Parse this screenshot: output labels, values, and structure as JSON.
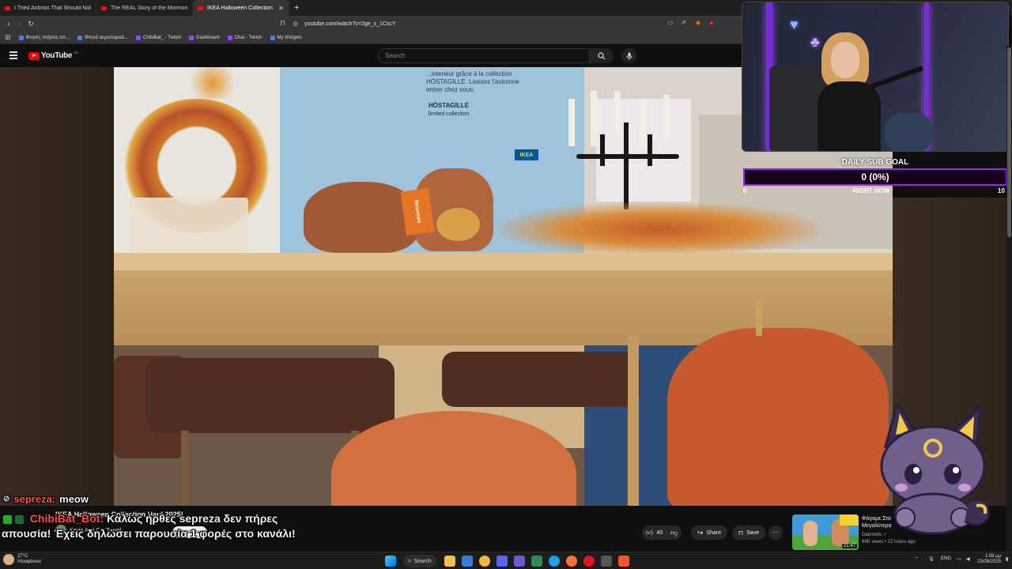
{
  "browser": {
    "tabs": [
      {
        "title": "I Tried Airbnbs That Should Not Exist",
        "active": false
      },
      {
        "title": "The REAL Story of the Mormon Church",
        "active": false
      },
      {
        "title": "IKEA Halloween Collection Haul 2025!",
        "active": true
      }
    ],
    "url": "youtube.com/watch?v=2ge_s_1CscY",
    "bookmarks": [
      "Φτηνές πτήσεις απ...",
      "Φτηνά αεροπορικά...",
      "ChibiBat_ - Twitch",
      "Dashboard",
      "Chat - Twitch",
      "My Widgets"
    ]
  },
  "youtube": {
    "logo_text": "YouTube",
    "country_code": "GR",
    "search_placeholder": "Search"
  },
  "scene": {
    "sign_line1": "...inteneur grâce à la collection",
    "sign_line2": "HÖSTAGILLE. Laissez l'automne",
    "sign_line3": "entrer chez vous.",
    "sign_title": "HÖSTAGILLE",
    "sign_sub": "limited collection",
    "tag_text": "Nouveau",
    "brand": "IKEA"
  },
  "sub_goal": {
    "title": "DAILY SUB GOAL",
    "value_text": "0 (0%)",
    "progress": 0,
    "min": "0",
    "max": "10",
    "label_now": "RIGHT NOW",
    "bar_color": "#a020f0"
  },
  "chat": [
    {
      "user": "sepreza:",
      "message": "meow"
    },
    {
      "user": "ChibiBat_Bot:",
      "message": "Καλώς ήρθες sepreza δεν πήρες"
    },
    {
      "message": "απουσία! Έχεις δηλώσει παρουσία 1 φορές στο κανάλι!"
    }
  ],
  "video": {
    "title": "IKEA Halloween Collection Haul 2025!",
    "channel": "Kevin And Cat Travel",
    "subscribe_label": "Subscribe",
    "likes": "40",
    "share_label": "Share",
    "save_label": "Save"
  },
  "recommended": {
    "title": "Φάγαμε Στα Μεγαλύτερα",
    "channel": "Giannells",
    "meta": "68K views • 22 hours ago",
    "duration": "21:47"
  },
  "taskbar": {
    "weather_temp": "27°C",
    "weather_desc": "Ηλιοφάνεια",
    "search_label": "Search",
    "lang": "ENG",
    "time": "1:08 μμ",
    "date": "23/09/2025"
  },
  "colors": {
    "yt_red": "#ff0000",
    "chat_name": "#ff4d4d",
    "goal_border": "#a020f0"
  }
}
